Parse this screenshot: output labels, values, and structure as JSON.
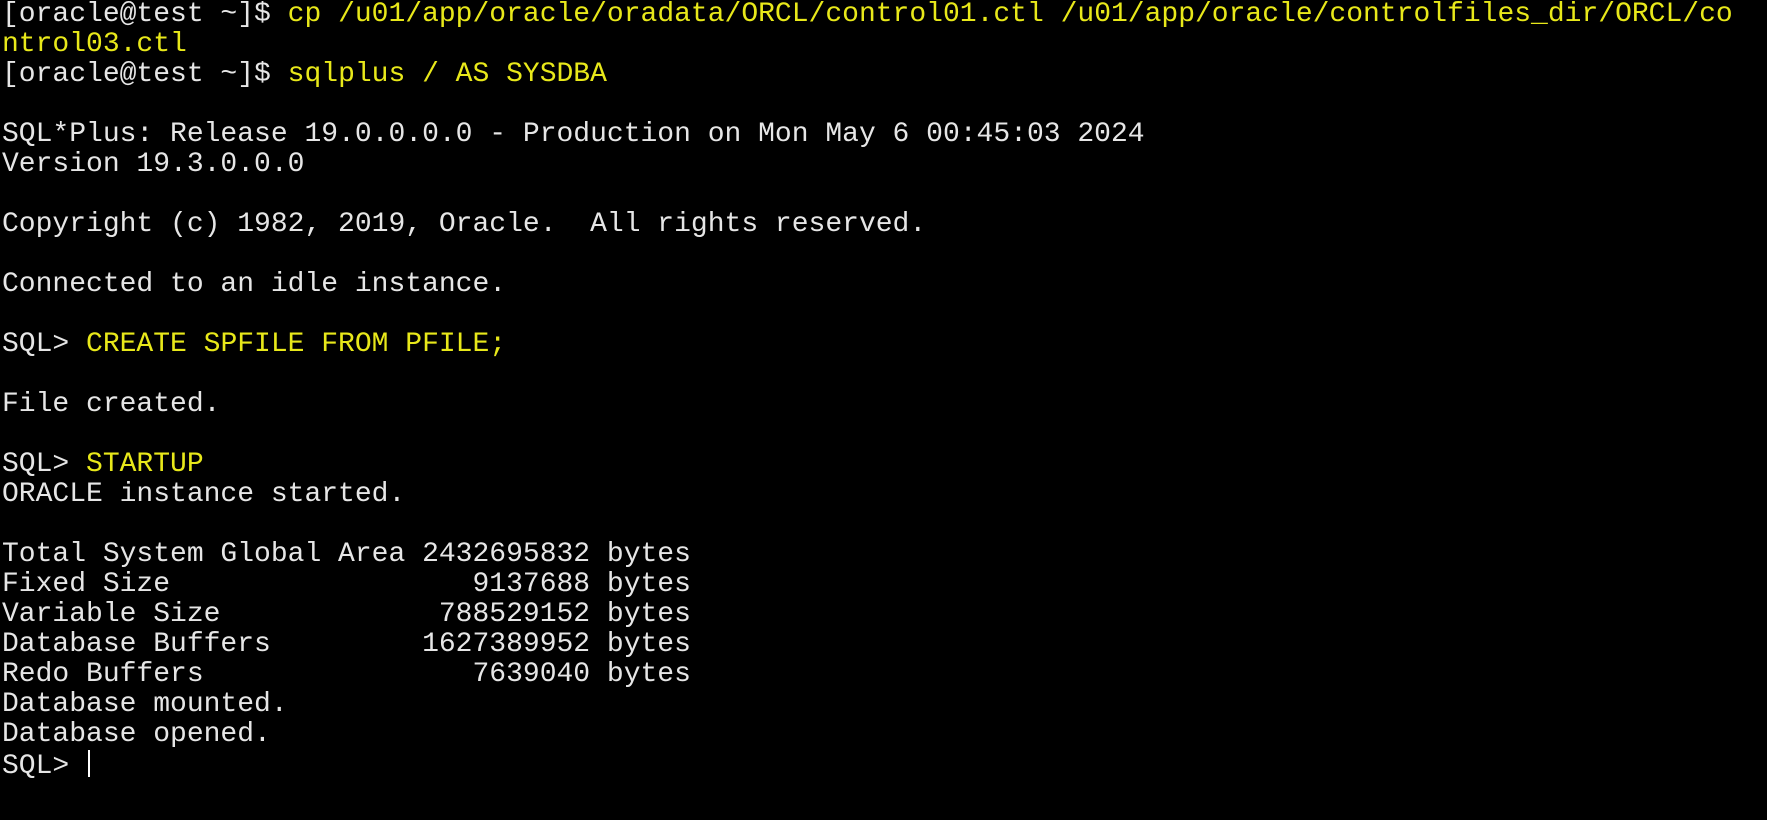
{
  "colors": {
    "background": "#000000",
    "output_text": "#e6e6e6",
    "command_text": "#e8e81a"
  },
  "terminal": {
    "lines": [
      {
        "prompt": "[oracle@test ~]$ ",
        "command": "cp /u01/app/oracle/oradata/ORCL/control01.ctl /u01/app/oracle/controlfiles_dir/ORCL/co"
      },
      {
        "prompt": "",
        "command": "ntrol03.ctl"
      },
      {
        "prompt": "[oracle@test ~]$ ",
        "command": "sqlplus / AS SYSDBA"
      },
      {
        "output": ""
      },
      {
        "output": "SQL*Plus: Release 19.0.0.0.0 - Production on Mon May 6 00:45:03 2024"
      },
      {
        "output": "Version 19.3.0.0.0"
      },
      {
        "output": ""
      },
      {
        "output": "Copyright (c) 1982, 2019, Oracle.  All rights reserved."
      },
      {
        "output": ""
      },
      {
        "output": "Connected to an idle instance."
      },
      {
        "output": ""
      },
      {
        "prompt": "SQL> ",
        "command": "CREATE SPFILE FROM PFILE;"
      },
      {
        "output": ""
      },
      {
        "output": "File created."
      },
      {
        "output": ""
      },
      {
        "prompt": "SQL> ",
        "command": "STARTUP"
      },
      {
        "output": "ORACLE instance started."
      },
      {
        "output": ""
      },
      {
        "output": "Total System Global Area 2432695832 bytes"
      },
      {
        "output": "Fixed Size                  9137688 bytes"
      },
      {
        "output": "Variable Size             788529152 bytes"
      },
      {
        "output": "Database Buffers         1627389952 bytes"
      },
      {
        "output": "Redo Buffers                7639040 bytes"
      },
      {
        "output": "Database mounted."
      },
      {
        "output": "Database opened."
      }
    ],
    "current_prompt": "SQL> "
  }
}
